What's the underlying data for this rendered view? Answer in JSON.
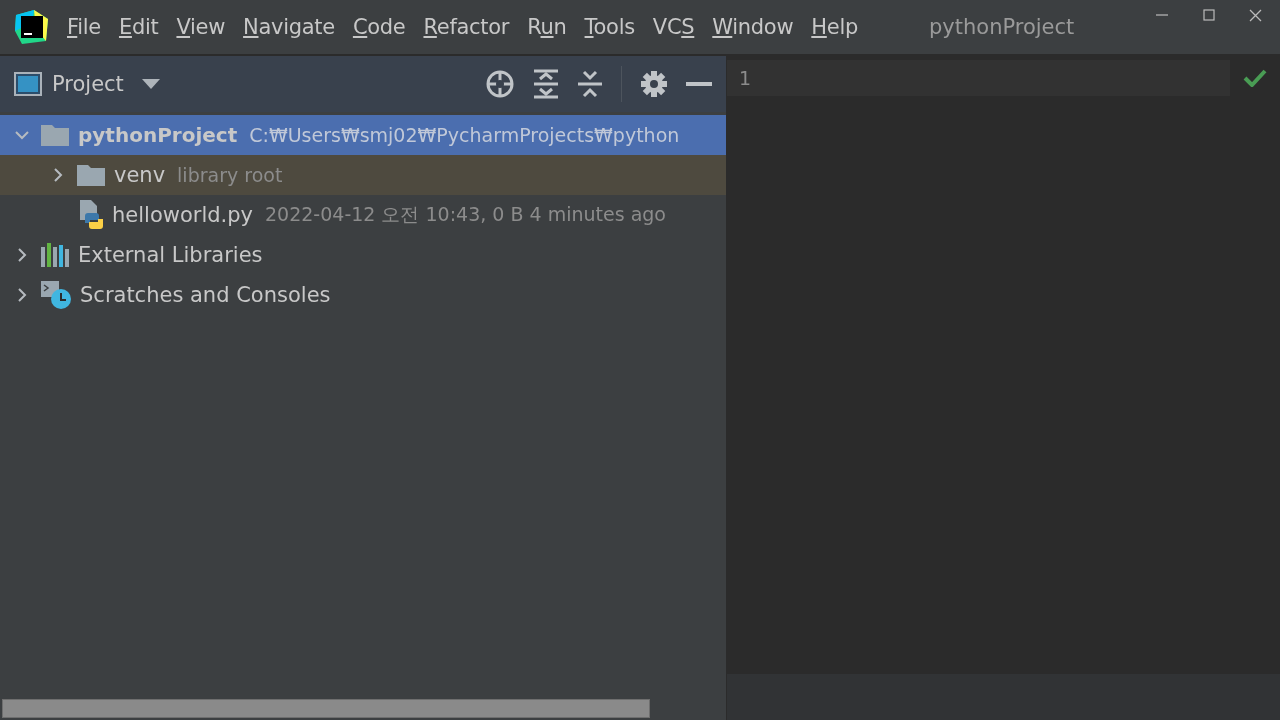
{
  "menu": [
    {
      "mnemonic": "F",
      "rest": "ile"
    },
    {
      "mnemonic": "E",
      "rest": "dit"
    },
    {
      "mnemonic": "V",
      "rest": "iew"
    },
    {
      "mnemonic": "N",
      "rest": "avigate"
    },
    {
      "mnemonic": "C",
      "rest": "ode"
    },
    {
      "mnemonic": "R",
      "rest": "efactor"
    },
    {
      "before": "R",
      "mnemonic": "u",
      "rest": "n"
    },
    {
      "mnemonic": "T",
      "rest": "ools"
    },
    {
      "before": "VC",
      "mnemonic": "S"
    },
    {
      "mnemonic": "W",
      "rest": "indow"
    },
    {
      "mnemonic": "H",
      "rest": "elp"
    }
  ],
  "window": {
    "title": "pythonProject"
  },
  "project_panel": {
    "title": "Project",
    "tree": [
      {
        "kind": "project-folder",
        "name": "pythonProject",
        "note": "C:₩Users₩smj02₩PycharmProjects₩python",
        "expanded": true,
        "selected": true,
        "children": [
          {
            "kind": "library-folder",
            "name": "venv",
            "note": "library root",
            "expanded": false,
            "selected": false
          },
          {
            "kind": "python-file",
            "name": "helloworld.py",
            "note": "2022-04-12 오전 10:43, 0 B 4 minutes ago",
            "selected": false
          }
        ]
      },
      {
        "kind": "libraries",
        "name": "External Libraries",
        "expanded": false,
        "selected": false
      },
      {
        "kind": "scratches",
        "name": "Scratches and Consoles",
        "expanded": false,
        "selected": false
      }
    ]
  },
  "editor": {
    "line_numbers": [
      "1"
    ]
  }
}
